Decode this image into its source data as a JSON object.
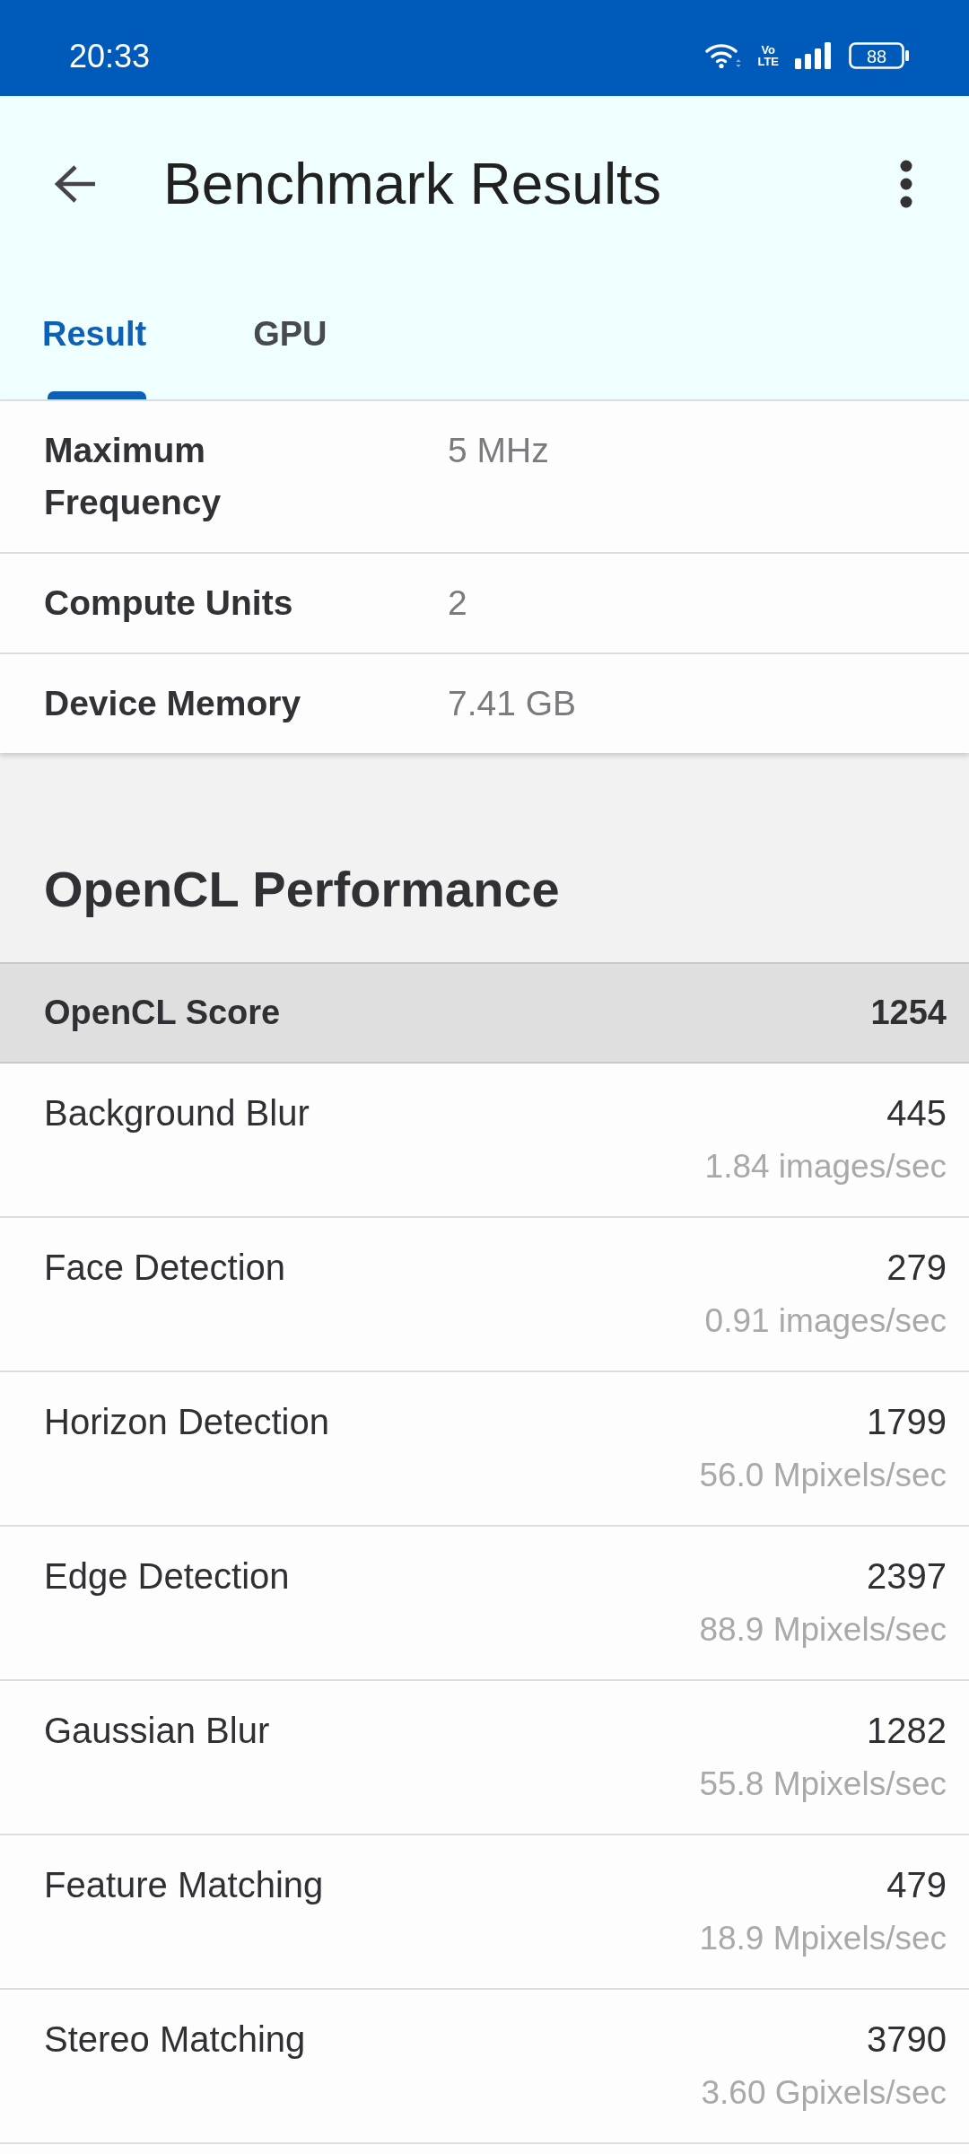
{
  "status_bar": {
    "time": "20:33",
    "network_label": {
      "top": "Vo",
      "bottom": "LTE"
    },
    "battery": "88"
  },
  "app_bar": {
    "title": "Benchmark Results"
  },
  "tabs": [
    {
      "label": "Result",
      "selected": true
    },
    {
      "label": "GPU",
      "selected": false
    }
  ],
  "device_info": [
    {
      "label": "Maximum Frequency",
      "value": "5 MHz"
    },
    {
      "label": "Compute Units",
      "value": "2"
    },
    {
      "label": "Device Memory",
      "value": "7.41 GB"
    }
  ],
  "performance": {
    "title": "OpenCL Performance",
    "score": {
      "label": "OpenCL Score",
      "value": "1254"
    },
    "results": [
      {
        "name": "Background Blur",
        "score": "445",
        "rate": "1.84 images/sec"
      },
      {
        "name": "Face Detection",
        "score": "279",
        "rate": "0.91 images/sec"
      },
      {
        "name": "Horizon Detection",
        "score": "1799",
        "rate": "56.0 Mpixels/sec"
      },
      {
        "name": "Edge Detection",
        "score": "2397",
        "rate": "88.9 Mpixels/sec"
      },
      {
        "name": "Gaussian Blur",
        "score": "1282",
        "rate": "55.8 Mpixels/sec"
      },
      {
        "name": "Feature Matching",
        "score": "479",
        "rate": "18.9 Mpixels/sec"
      },
      {
        "name": "Stereo Matching",
        "score": "3790",
        "rate": "3.60 Gpixels/sec"
      }
    ]
  }
}
